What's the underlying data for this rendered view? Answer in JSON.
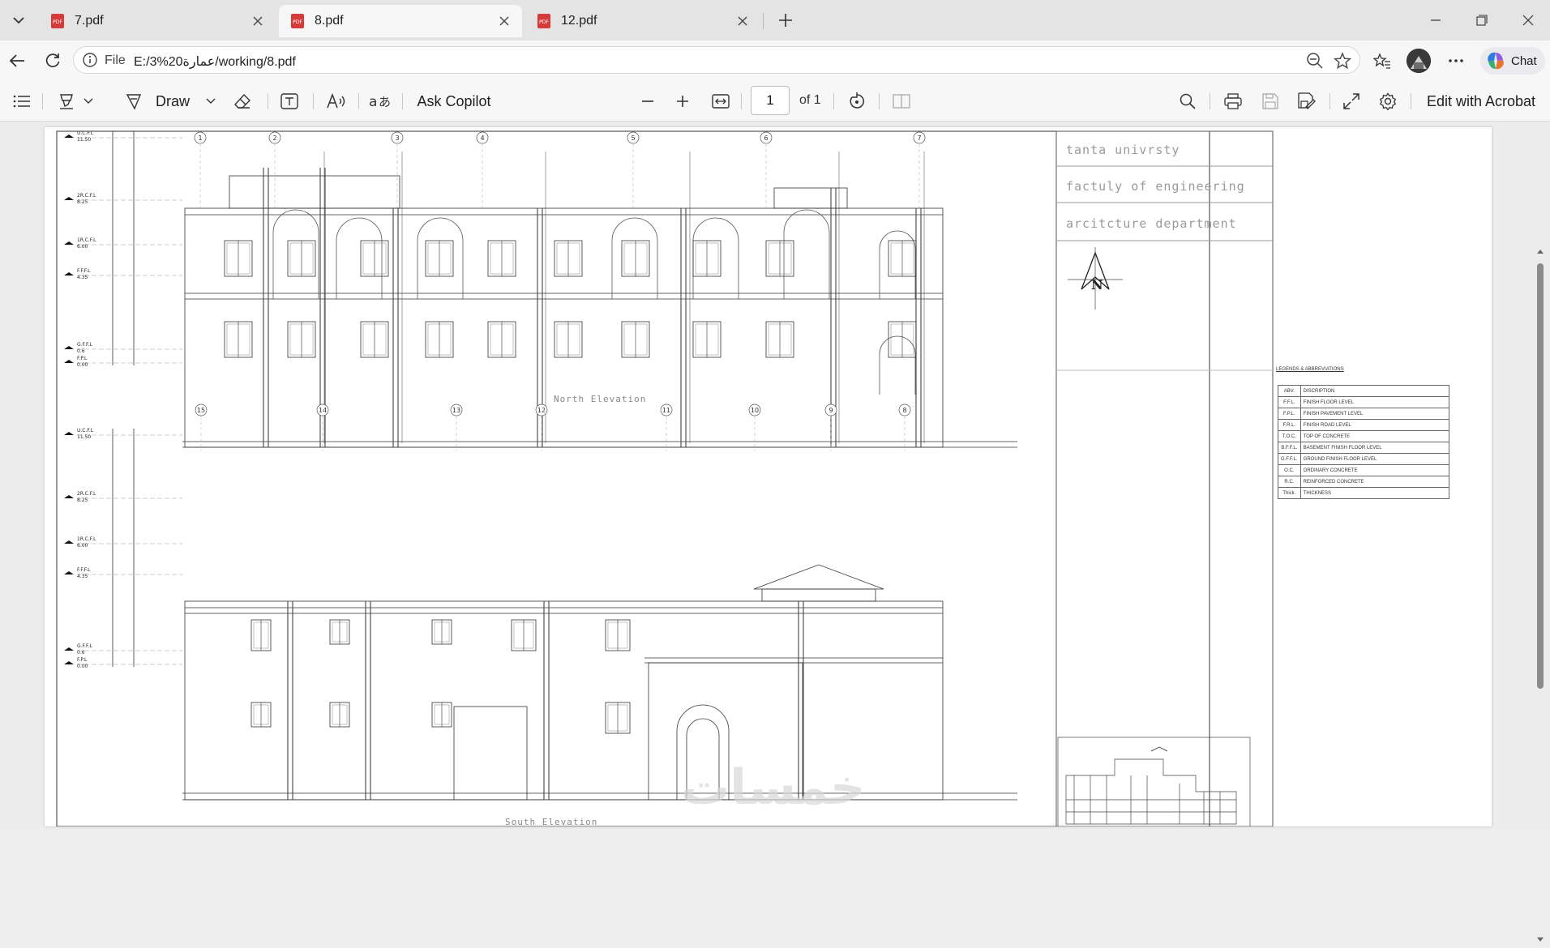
{
  "tabs": [
    {
      "title": "7.pdf",
      "active": false
    },
    {
      "title": "8.pdf",
      "active": true
    },
    {
      "title": "12.pdf",
      "active": false
    }
  ],
  "address": {
    "scheme": "File",
    "url": "E:/3%20عمارة/working/8.pdf"
  },
  "chat_label": "Chat",
  "toolbar": {
    "draw_label": "Draw",
    "ask_copilot_label": "Ask Copilot",
    "page_value": "1",
    "of_pages": "of 1",
    "edit_acrobat_label": "Edit with Acrobat"
  },
  "icons": [
    "tab-list-icon",
    "pdf-icon",
    "close-icon",
    "plus-icon",
    "minimize-icon",
    "restore-icon",
    "back-icon",
    "refresh-icon",
    "info-icon",
    "zoom-out-icon",
    "star-icon",
    "favorites-icon",
    "more-icon",
    "copilot-icon",
    "contents-icon",
    "highlight-icon",
    "draw-icon",
    "eraser-icon",
    "text-box-icon",
    "read-aloud-icon",
    "translate-icon",
    "minus-icon",
    "fit-width-icon",
    "rotate-icon",
    "two-page-icon",
    "search-icon",
    "print-icon",
    "save-icon",
    "save-as-icon",
    "fullscreen-icon",
    "settings-icon"
  ],
  "drawing": {
    "title_block": [
      "tanta univrsty",
      "factuly of engineering",
      "arcitcture department"
    ],
    "north_label": "N",
    "north_elevation_title": "North Elevation",
    "south_elevation_title": "South Elevation",
    "grid_top": [
      "1",
      "2",
      "3",
      "4",
      "5",
      "6",
      "7"
    ],
    "grid_middle": [
      "15",
      "14",
      "13",
      "12",
      "11",
      "10",
      "9",
      "8"
    ],
    "levels_north": [
      {
        "name": "U.C.F.L",
        "value": "11.50"
      },
      {
        "name": "2R.C.F.L",
        "value": "8.25"
      },
      {
        "name": "1R.C.F.L",
        "value": "6.00"
      },
      {
        "name": "F.F.F.L",
        "value": "4.35"
      },
      {
        "name": "G.F.F.L",
        "value": "0.6"
      },
      {
        "name": "F.P.L",
        "value": "0.00"
      }
    ],
    "levels_south": [
      {
        "name": "U.C.F.L",
        "value": "11.50"
      },
      {
        "name": "2R.C.F.L",
        "value": "8.25"
      },
      {
        "name": "1R.C.F.L",
        "value": "6.00"
      },
      {
        "name": "F.F.F.L",
        "value": "4.35"
      },
      {
        "name": "G.F.F.L",
        "value": "0.6"
      },
      {
        "name": "F.P.L",
        "value": "0.00"
      }
    ],
    "legend_title": "LEGENDS & ABBREVIATIONS",
    "legend": [
      {
        "abv": "ABV.",
        "desc": "DISCRIPTION"
      },
      {
        "abv": "F.F.L.",
        "desc": "FINISH FLOOR LEVEL"
      },
      {
        "abv": "F.P.L.",
        "desc": "FINISH PAVEMENT LEVEL"
      },
      {
        "abv": "F.R.L.",
        "desc": "FINISH ROAD LEVEL"
      },
      {
        "abv": "T.O.C.",
        "desc": "TOP OF CONCRETE"
      },
      {
        "abv": "B.F.F.L.",
        "desc": "BASEMENT FINISH FLOOR LEVEL"
      },
      {
        "abv": "G.F.F.L.",
        "desc": "GROUND FINISH FLOOR LEVEL"
      },
      {
        "abv": "O.C.",
        "desc": "ORDINARY CONCRETE"
      },
      {
        "abv": "R.C.",
        "desc": "REINFORCED CONCRETE"
      },
      {
        "abv": "Thick.",
        "desc": "THICKNESS"
      }
    ],
    "watermark": "خمسات"
  }
}
